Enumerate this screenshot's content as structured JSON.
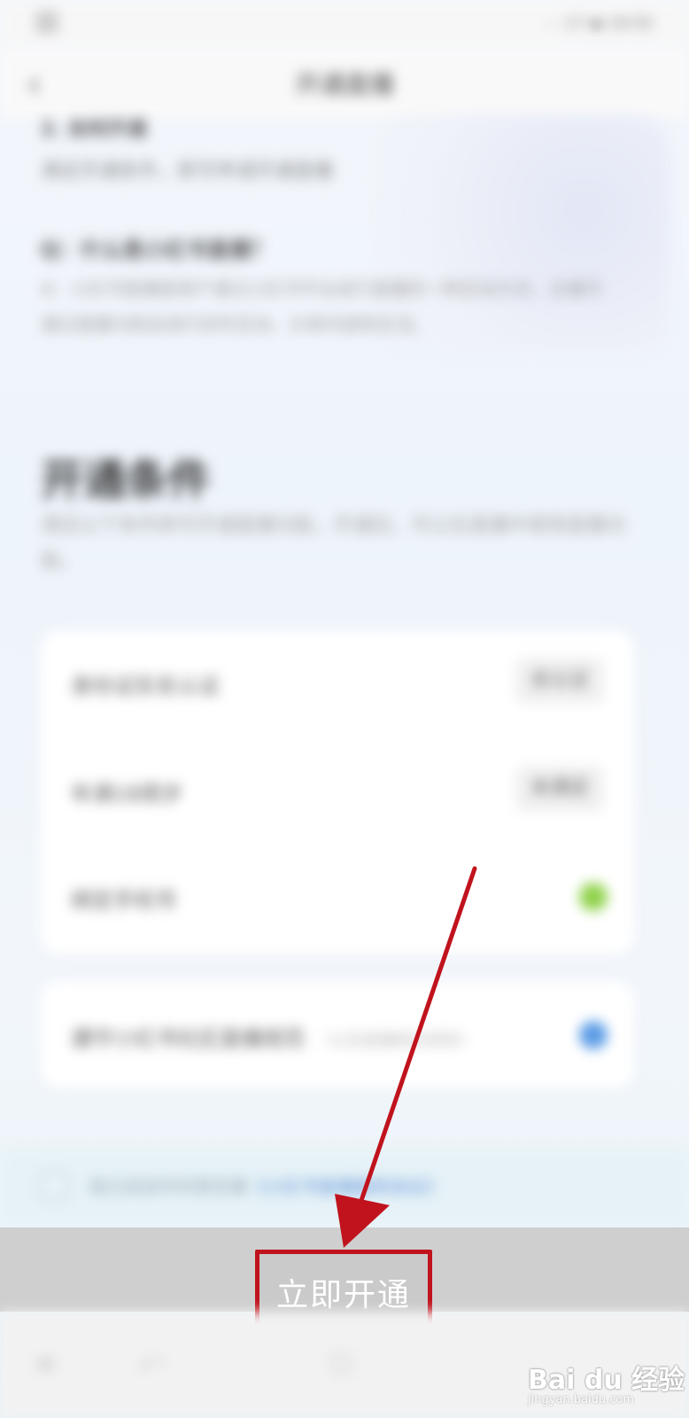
{
  "status_bar": {
    "left_icon": "app-icon",
    "right_text": "⋯ 17 ◆ 19:55"
  },
  "header": {
    "back_icon": "chevron-left-icon",
    "title": "开通直播"
  },
  "faq": {
    "item2_title": "2. 如何开通",
    "item2_text": "满足开通条件，即可申请开通直播",
    "item3_title": "Q：什么是小红书直播？",
    "item3_text": "A：小红书直播是用户通过小红书平台进行直播的一种互动方式，主播可通过直播与粉丝进行实时互动、分享内容和生活。"
  },
  "conditions": {
    "title": "开通条件",
    "desc": "满足以下条件即可开通直播功能，开通后，可以在直播中使用直播功能。",
    "rows": [
      {
        "label": "身份证实名认证",
        "action": "去认证",
        "status": "button"
      },
      {
        "label": "年满18周岁",
        "action": "未满足",
        "status": "button"
      },
      {
        "label": "绑定手机号",
        "status": "done",
        "status_color": "#8fd24a"
      },
      {
        "label": "遵守小红书社区直播规范",
        "sub": "（以及直播相关规则）",
        "status": "info",
        "status_color": "#5b9ce6"
      }
    ]
  },
  "agreement": {
    "text": "我已阅读并同意签署",
    "link": "《小红书直播服务协议》"
  },
  "bottom": {
    "open_button_label": "立即开通"
  },
  "watermark": {
    "text": "Bai du 经验",
    "url": "jingyan.baidu.com"
  },
  "annotation": {
    "color": "#c0131d"
  }
}
